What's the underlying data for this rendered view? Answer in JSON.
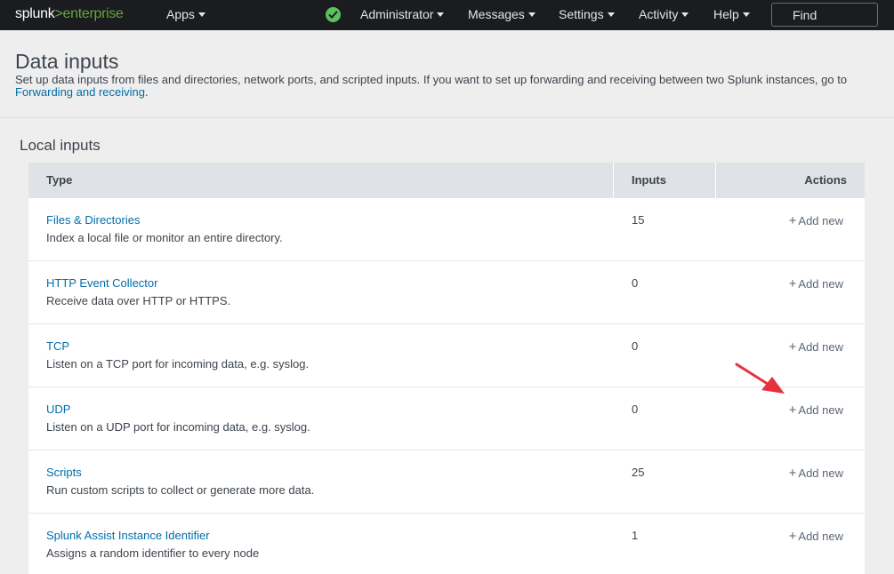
{
  "topbar": {
    "logo_main": "splunk",
    "logo_gt": ">",
    "logo_product": "enterprise",
    "apps": "Apps",
    "status_icon": "check-circle-icon",
    "administrator": "Administrator",
    "messages": "Messages",
    "settings": "Settings",
    "activity": "Activity",
    "help": "Help",
    "find": "Find"
  },
  "header": {
    "title": "Data inputs",
    "description": "Set up data inputs from files and directories, network ports, and scripted inputs. If you want to set up forwarding and receiving between two Splunk instances, go to",
    "link": "Forwarding and receiving",
    "period": "."
  },
  "section": {
    "title": "Local inputs"
  },
  "table": {
    "columns": {
      "type": "Type",
      "inputs": "Inputs",
      "actions": "Actions"
    },
    "rows": [
      {
        "name": "Files & Directories",
        "desc": "Index a local file or monitor an entire directory.",
        "count": "15",
        "action": "Add new"
      },
      {
        "name": "HTTP Event Collector",
        "desc": "Receive data over HTTP or HTTPS.",
        "count": "0",
        "action": "Add new"
      },
      {
        "name": "TCP",
        "desc": "Listen on a TCP port for incoming data, e.g. syslog.",
        "count": "0",
        "action": "Add new"
      },
      {
        "name": "UDP",
        "desc": "Listen on a UDP port for incoming data, e.g. syslog.",
        "count": "0",
        "action": "Add new"
      },
      {
        "name": "Scripts",
        "desc": "Run custom scripts to collect or generate more data.",
        "count": "25",
        "action": "Add new"
      },
      {
        "name": "Splunk Assist Instance Identifier",
        "desc": "Assigns a random identifier to every node",
        "count": "1",
        "action": "Add new"
      }
    ]
  },
  "colors": {
    "topbar_bg": "#1a1c20",
    "brand_green": "#65a637",
    "link_blue": "#006eaa",
    "annotation_red": "#e8313f"
  }
}
